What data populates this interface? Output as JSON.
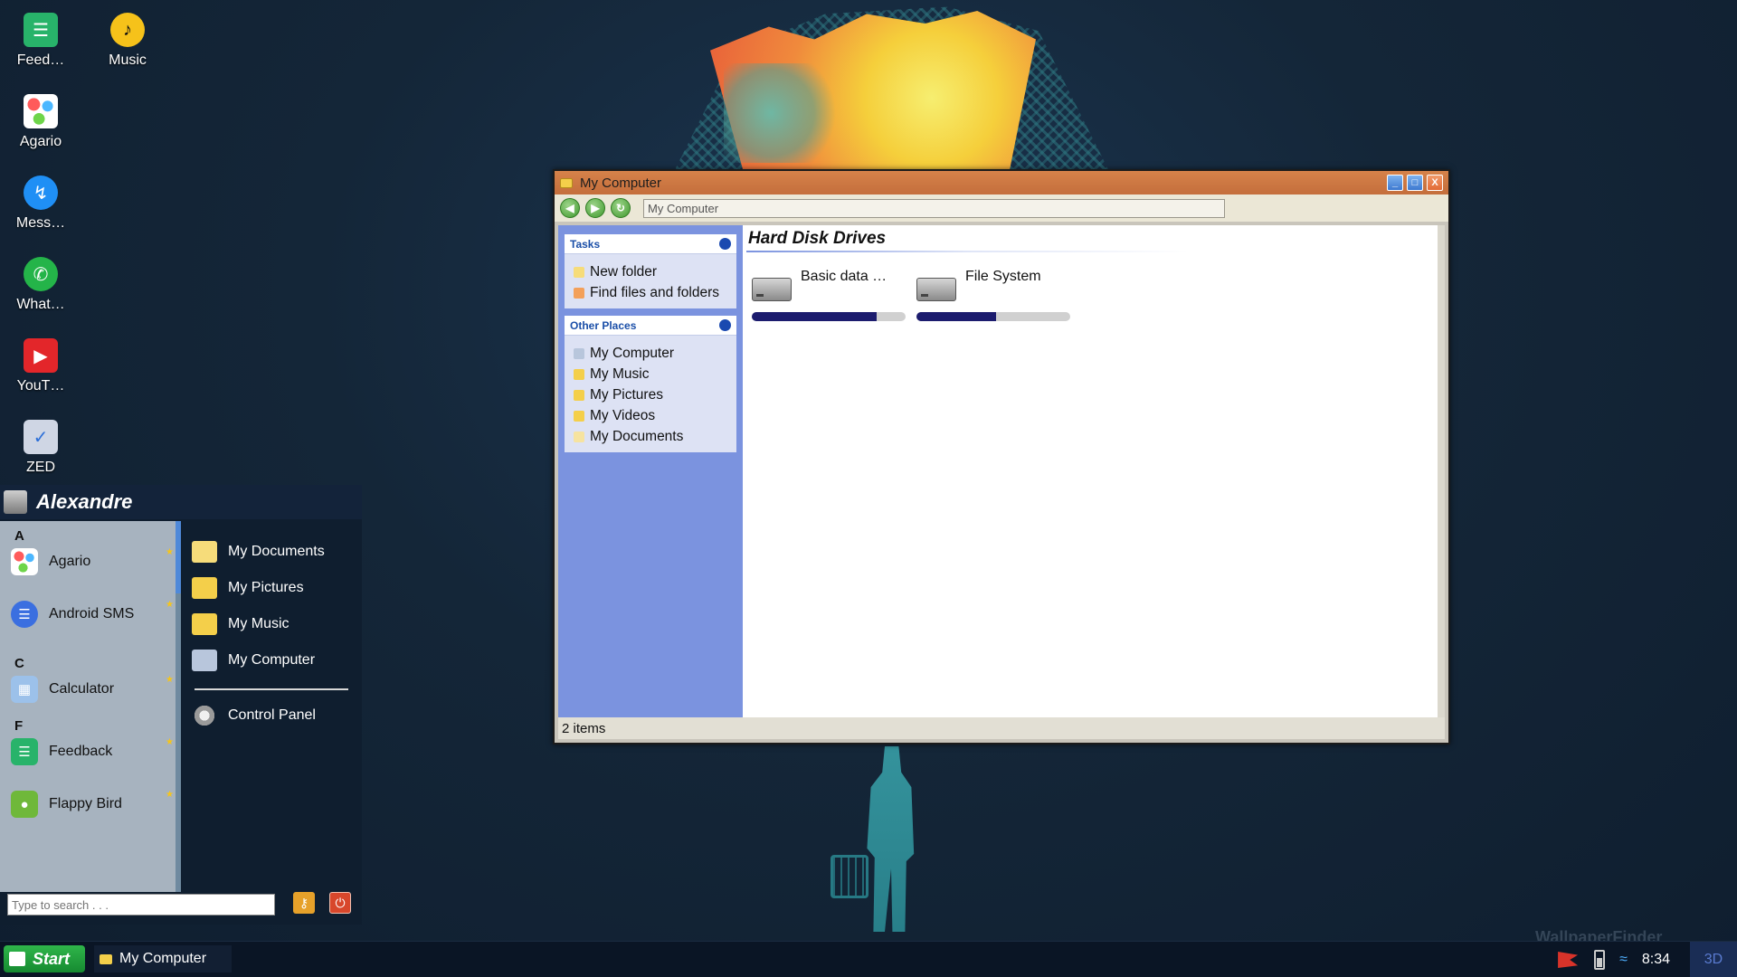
{
  "desktop": {
    "icons": [
      {
        "label": "Feed…",
        "icon": "feedback-icon",
        "color": "#28b36a"
      },
      {
        "label": "Music",
        "icon": "music-icon",
        "color": "#f6c21a"
      },
      {
        "label": "Agario",
        "icon": "agario-icon",
        "color": "#ffffff"
      },
      {
        "label": "Mess…",
        "icon": "messenger-icon",
        "color": "#1f8ff5"
      },
      {
        "label": "What…",
        "icon": "whatsapp-icon",
        "color": "#24b449"
      },
      {
        "label": "YouT…",
        "icon": "youtube-icon",
        "color": "#e3262a"
      },
      {
        "label": "ZED",
        "icon": "zed-icon",
        "color": "#cfd6e4"
      }
    ],
    "watermark": "WallpaperFinder"
  },
  "window": {
    "title": "My Computer",
    "address": "My Computer",
    "tasks": {
      "heading": "Tasks",
      "items": [
        "New folder",
        "Find files and folders"
      ]
    },
    "other_places": {
      "heading": "Other Places",
      "items": [
        "My Computer",
        "My Music",
        "My Pictures",
        "My Videos",
        "My Documents"
      ]
    },
    "section_title": "Hard Disk Drives",
    "drives": [
      {
        "name": "Basic data …",
        "used_fraction": 0.81
      },
      {
        "name": "File System",
        "used_fraction": 0.52
      }
    ],
    "status": "2 items"
  },
  "start_menu": {
    "user": "Alexandre",
    "groups": [
      {
        "letter": "A",
        "apps": [
          {
            "name": "Agario",
            "icon": "agario-icon",
            "color": "#ffffff"
          },
          {
            "name": "Android SMS",
            "icon": "sms-icon",
            "color": "#3b6fe0"
          }
        ]
      },
      {
        "letter": "C",
        "apps": [
          {
            "name": "Calculator",
            "icon": "calculator-icon",
            "color": "#9cc1ea"
          }
        ]
      },
      {
        "letter": "F",
        "apps": [
          {
            "name": "Feedback",
            "icon": "feedback-icon",
            "color": "#28b36a"
          },
          {
            "name": "Flappy Bird",
            "icon": "flappy-bird-icon",
            "color": "#6fb83a"
          }
        ]
      }
    ],
    "places": [
      "My Documents",
      "My Pictures",
      "My Music",
      "My Computer"
    ],
    "control_panel": "Control Panel",
    "search_placeholder": "Type to search . . ."
  },
  "taskbar": {
    "start_label": "Start",
    "open_window": "My Computer",
    "clock": "8:34",
    "mode": "3D"
  }
}
